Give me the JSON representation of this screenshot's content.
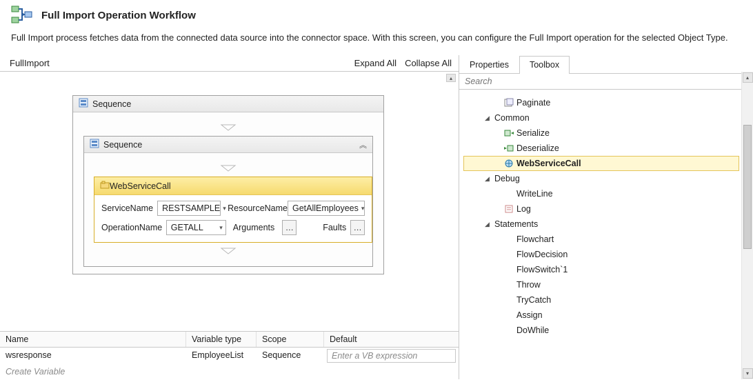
{
  "header": {
    "title": "Full Import Operation Workflow",
    "description": "Full Import process fetches data from the connected data source into the connector space. With this screen, you can configure the Full Import operation for the selected Object Type."
  },
  "designer": {
    "breadcrumb": "FullImport",
    "expand_all": "Expand All",
    "collapse_all": "Collapse All",
    "seq_outer_label": "Sequence",
    "seq_inner_label": "Sequence",
    "wsc": {
      "title": "WebServiceCall",
      "service_name_label": "ServiceName",
      "service_name_value": "RESTSAMPLE",
      "resource_name_label": "ResourceName",
      "resource_name_value": "GetAllEmployees",
      "operation_name_label": "OperationName",
      "operation_name_value": "GETALL",
      "arguments_label": "Arguments",
      "faults_label": "Faults"
    }
  },
  "vars": {
    "cols": {
      "name": "Name",
      "type": "Variable type",
      "scope": "Scope",
      "default": "Default"
    },
    "row": {
      "name": "wsresponse",
      "type": "EmployeeList",
      "scope": "Sequence",
      "default_ph": "Enter a VB expression"
    },
    "create_label": "Create Variable"
  },
  "side": {
    "tabs": {
      "properties": "Properties",
      "toolbox": "Toolbox"
    },
    "search_placeholder": "Search",
    "tree": {
      "paginate": "Paginate",
      "common": "Common",
      "serialize": "Serialize",
      "deserialize": "Deserialize",
      "webservicecall": "WebServiceCall",
      "debug": "Debug",
      "writeline": "WriteLine",
      "log": "Log",
      "statements": "Statements",
      "flowchart": "Flowchart",
      "flowdecision": "FlowDecision",
      "flowswitch": "FlowSwitch`1",
      "throw": "Throw",
      "trycatch": "TryCatch",
      "assign": "Assign",
      "dowhile": "DoWhile"
    }
  }
}
